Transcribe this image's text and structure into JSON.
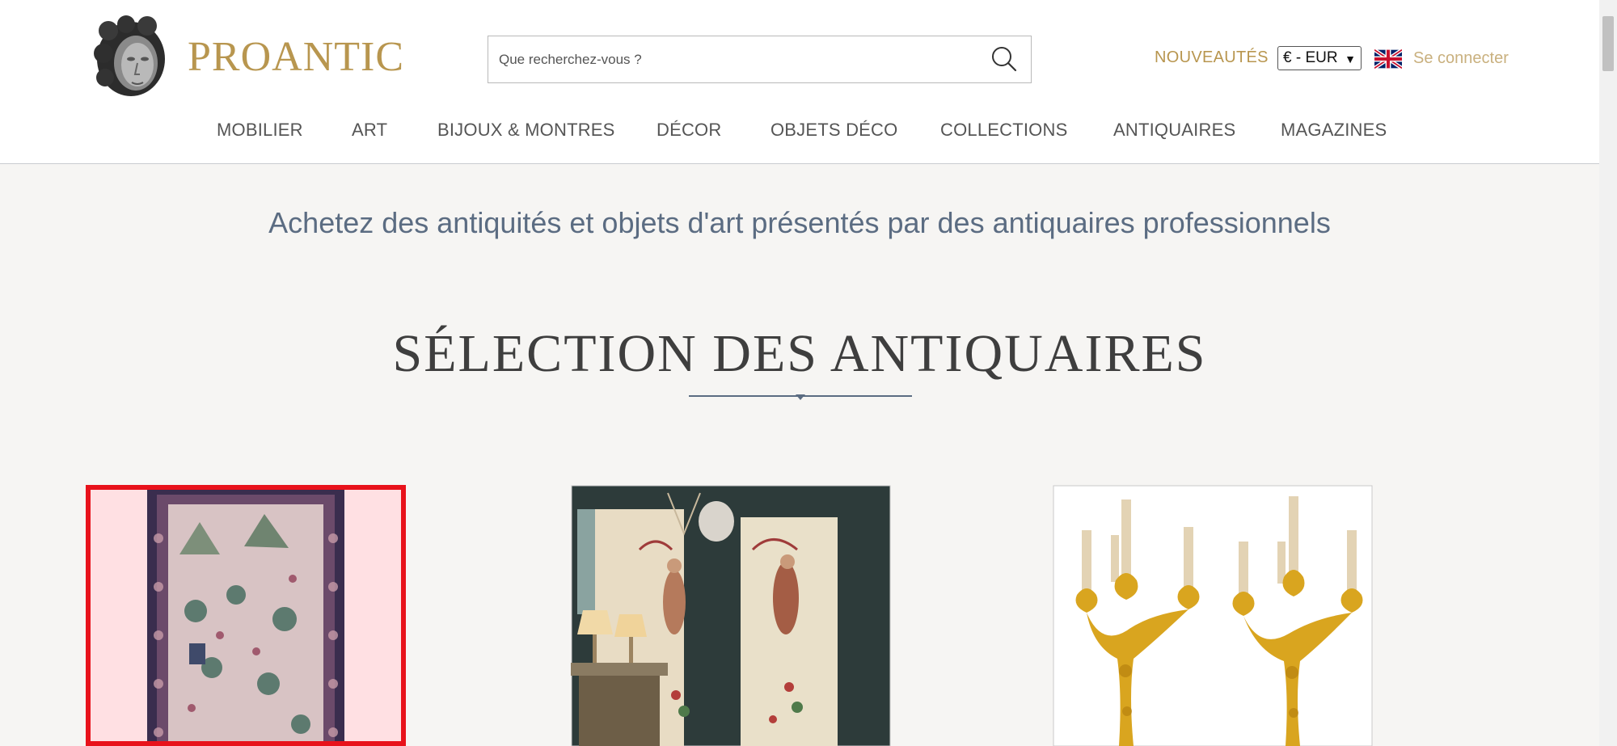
{
  "header": {
    "logo_text": "PROANTIC",
    "search_placeholder": "Que recherchez-vous ?",
    "nouveautes": "NOUVEAUTÉS",
    "currency": "€ - EUR",
    "login": "Se connecter"
  },
  "nav": [
    {
      "label": "MOBILIER"
    },
    {
      "label": "ART"
    },
    {
      "label": "BIJOUX & MONTRES"
    },
    {
      "label": "DÉCOR"
    },
    {
      "label": "OBJETS DÉCO"
    },
    {
      "label": "COLLECTIONS"
    },
    {
      "label": "ANTIQUAIRES"
    },
    {
      "label": "MAGAZINES"
    }
  ],
  "tagline": "Achetez des antiquités et objets d'art présentés par des antiquaires professionnels",
  "section_title": "SÉLECTION DES ANTIQUAIRES",
  "products": [
    {
      "subject": "persian-rug"
    },
    {
      "subject": "painted-panels"
    },
    {
      "subject": "gilt-candelabra"
    }
  ],
  "colors": {
    "accent_gold": "#b8964f",
    "login_gold": "#c9b07e",
    "heading_blue": "#5b6c82",
    "selection_red": "#e8121b"
  }
}
